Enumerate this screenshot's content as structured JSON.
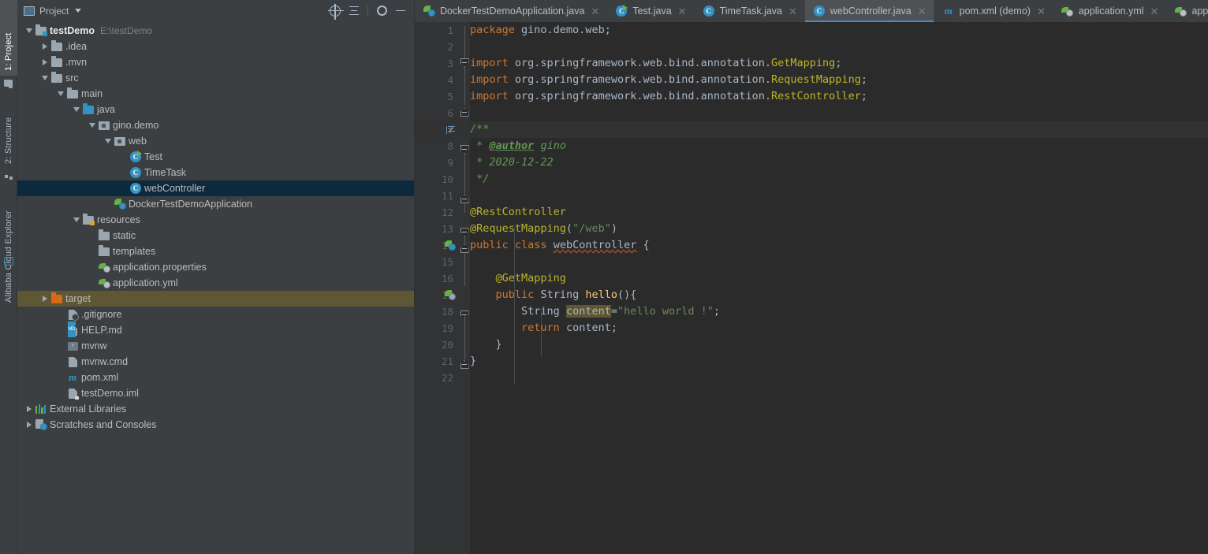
{
  "toolwindows": {
    "left": [
      {
        "label": "1: Project",
        "icon": "project-icon",
        "active": true
      },
      {
        "label": "2: Structure",
        "icon": "structure-icon",
        "active": false
      },
      {
        "label": "Alibaba Cloud Explorer",
        "icon": "cloud-icon",
        "active": false
      }
    ]
  },
  "project_panel": {
    "title": "Project",
    "actions": [
      {
        "name": "locate-icon",
        "tooltip": "Select Opened File"
      },
      {
        "name": "collapse-all-icon",
        "tooltip": "Collapse All"
      },
      {
        "name": "gear-icon",
        "tooltip": "Settings"
      },
      {
        "name": "minimize-icon",
        "tooltip": "Hide"
      }
    ],
    "tree": [
      {
        "label": "testDemo",
        "sub": "E:\\testDemo",
        "indent": 0,
        "arrow": "open",
        "icon": "module-folder-icon",
        "bold": true
      },
      {
        "label": ".idea",
        "indent": 1,
        "arrow": "closed",
        "icon": "folder-icon"
      },
      {
        "label": ".mvn",
        "indent": 1,
        "arrow": "closed",
        "icon": "folder-icon"
      },
      {
        "label": "src",
        "indent": 1,
        "arrow": "open",
        "icon": "folder-icon"
      },
      {
        "label": "main",
        "indent": 2,
        "arrow": "open",
        "icon": "folder-icon"
      },
      {
        "label": "java",
        "indent": 3,
        "arrow": "open",
        "icon": "source-root-icon"
      },
      {
        "label": "gino.demo",
        "indent": 4,
        "arrow": "open",
        "icon": "package-icon"
      },
      {
        "label": "web",
        "indent": 5,
        "arrow": "open",
        "icon": "package-icon"
      },
      {
        "label": "Test",
        "indent": 6,
        "arrow": "none",
        "icon": "java-class-runnable-icon"
      },
      {
        "label": "TimeTask",
        "indent": 6,
        "arrow": "none",
        "icon": "java-class-icon"
      },
      {
        "label": "webController",
        "indent": 6,
        "arrow": "none",
        "icon": "java-class-icon",
        "selected": true
      },
      {
        "label": "DockerTestDemoApplication",
        "indent": 5,
        "arrow": "none",
        "icon": "spring-boot-class-icon"
      },
      {
        "label": "resources",
        "indent": 3,
        "arrow": "open",
        "icon": "resource-root-icon"
      },
      {
        "label": "static",
        "indent": 4,
        "arrow": "none",
        "icon": "folder-icon"
      },
      {
        "label": "templates",
        "indent": 4,
        "arrow": "none",
        "icon": "folder-icon"
      },
      {
        "label": "application.properties",
        "indent": 4,
        "arrow": "none",
        "icon": "spring-config-icon"
      },
      {
        "label": "application.yml",
        "indent": 4,
        "arrow": "none",
        "icon": "spring-config-icon"
      },
      {
        "label": "target",
        "indent": 1,
        "arrow": "closed",
        "icon": "excluded-folder-icon",
        "highlight": true
      },
      {
        "label": ".gitignore",
        "indent": 2,
        "arrow": "none",
        "icon": "gitignore-file-icon"
      },
      {
        "label": "HELP.md",
        "indent": 2,
        "arrow": "none",
        "icon": "markdown-file-icon"
      },
      {
        "label": "mvnw",
        "indent": 2,
        "arrow": "none",
        "icon": "shell-script-icon"
      },
      {
        "label": "mvnw.cmd",
        "indent": 2,
        "arrow": "none",
        "icon": "cmd-script-icon"
      },
      {
        "label": "pom.xml",
        "indent": 2,
        "arrow": "none",
        "icon": "maven-pom-icon"
      },
      {
        "label": "testDemo.iml",
        "indent": 2,
        "arrow": "none",
        "icon": "iml-module-icon"
      },
      {
        "label": "External Libraries",
        "indent": 0,
        "arrow": "closed",
        "icon": "libraries-icon"
      },
      {
        "label": "Scratches and Consoles",
        "indent": 0,
        "arrow": "closed",
        "icon": "scratches-icon"
      }
    ]
  },
  "editor": {
    "tabs": [
      {
        "label": "DockerTestDemoApplication.java",
        "icon": "spring-boot-class-icon",
        "active": false,
        "closable": true
      },
      {
        "label": "Test.java",
        "icon": "java-class-runnable-icon",
        "active": false,
        "closable": true
      },
      {
        "label": "TimeTask.java",
        "icon": "java-class-icon",
        "active": false,
        "closable": true
      },
      {
        "label": "webController.java",
        "icon": "java-class-icon",
        "active": true,
        "closable": true
      },
      {
        "label": "pom.xml (demo)",
        "icon": "maven-pom-icon",
        "active": false,
        "closable": true
      },
      {
        "label": "application.yml",
        "icon": "spring-config-icon",
        "active": false,
        "closable": true
      },
      {
        "label": "applica",
        "icon": "spring-config-icon",
        "active": false,
        "closable": false
      }
    ],
    "current_line": 7,
    "line_numbers": [
      1,
      2,
      3,
      4,
      5,
      6,
      7,
      8,
      9,
      10,
      11,
      12,
      13,
      14,
      15,
      16,
      17,
      18,
      19,
      20,
      21,
      22
    ],
    "code_lines": [
      {
        "n": 1,
        "text": "package gino.demo.web;"
      },
      {
        "n": 2,
        "text": ""
      },
      {
        "n": 3,
        "text": "import org.springframework.web.bind.annotation.GetMapping;"
      },
      {
        "n": 4,
        "text": "import org.springframework.web.bind.annotation.RequestMapping;"
      },
      {
        "n": 5,
        "text": "import org.springframework.web.bind.annotation.RestController;"
      },
      {
        "n": 6,
        "text": ""
      },
      {
        "n": 7,
        "text": "/**"
      },
      {
        "n": 8,
        "text": " * @author gino"
      },
      {
        "n": 9,
        "text": " * 2020-12-22"
      },
      {
        "n": 10,
        "text": " */"
      },
      {
        "n": 11,
        "text": ""
      },
      {
        "n": 12,
        "text": "@RestController"
      },
      {
        "n": 13,
        "text": "@RequestMapping(\"/web\")"
      },
      {
        "n": 14,
        "text": "public class webController {"
      },
      {
        "n": 15,
        "text": ""
      },
      {
        "n": 16,
        "text": "    @GetMapping"
      },
      {
        "n": 17,
        "text": "    public String hello(){"
      },
      {
        "n": 18,
        "text": "        String content=\"hello world !\";"
      },
      {
        "n": 19,
        "text": "        return content;"
      },
      {
        "n": 20,
        "text": "    }"
      },
      {
        "n": 21,
        "text": "}"
      },
      {
        "n": 22,
        "text": ""
      }
    ],
    "gutter_markers": [
      {
        "line": 7,
        "icon": "javadoc-icon"
      },
      {
        "line": 14,
        "icon": "spring-bean-icon"
      },
      {
        "line": 17,
        "icon": "spring-mapping-icon"
      }
    ],
    "highlighted_identifier": "content"
  },
  "colors": {
    "panel_bg": "#3c3f41",
    "editor_bg": "#2b2b2b",
    "gutter_bg": "#313335",
    "selection_bg": "#0d293e",
    "highlight_row_bg": "#5f5636",
    "active_tab_bg": "#4e5254",
    "tab_underline": "#4a88c7",
    "keyword": "#cc7832",
    "string": "#6a8759",
    "comment": "#629755",
    "annotation": "#bbb529",
    "text": "#a9b7c6",
    "method": "#ffc66d"
  }
}
